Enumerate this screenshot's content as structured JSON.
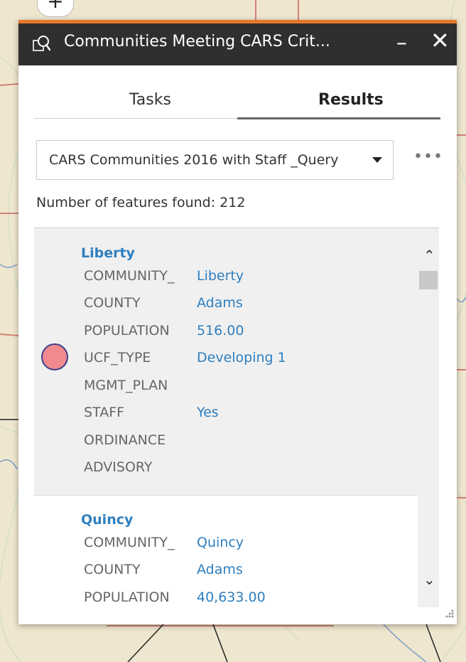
{
  "colors": {
    "accent": "#e5782a",
    "header_bg": "#2f2f2f",
    "link_blue": "#2f7fbf",
    "symbol_fill": "#f08a8f",
    "symbol_stroke": "#3f3f8a"
  },
  "map": {
    "zoom_in_label": "+"
  },
  "panel": {
    "title": "Communities Meeting CARS Crit...",
    "minimize_label": "–",
    "close_label": "✕",
    "header_icon": "query-icon",
    "tabs": [
      {
        "label": "Tasks",
        "active": false
      },
      {
        "label": "Results",
        "active": true
      }
    ],
    "layer_select": {
      "value": "CARS Communities 2016 with Staff _Query"
    },
    "more_label": "•••",
    "features_found": "Number of features found: 212",
    "results": [
      {
        "title": "Liberty",
        "attributes": [
          {
            "key": "COMMUNITY_",
            "value": "Liberty"
          },
          {
            "key": "COUNTY",
            "value": "Adams"
          },
          {
            "key": "POPULATION",
            "value": "516.00"
          },
          {
            "key": "UCF_TYPE",
            "value": "Developing 1"
          },
          {
            "key": "MGMT_PLAN",
            "value": ""
          },
          {
            "key": "STAFF",
            "value": "Yes"
          },
          {
            "key": "ORDINANCE",
            "value": ""
          },
          {
            "key": "ADVISORY",
            "value": ""
          }
        ]
      },
      {
        "title": "Quincy",
        "attributes": [
          {
            "key": "COMMUNITY_",
            "value": "Quincy"
          },
          {
            "key": "COUNTY",
            "value": "Adams"
          },
          {
            "key": "POPULATION",
            "value": "40,633.00"
          }
        ]
      }
    ],
    "scroll_up": "⌃",
    "scroll_down": "⌄"
  }
}
